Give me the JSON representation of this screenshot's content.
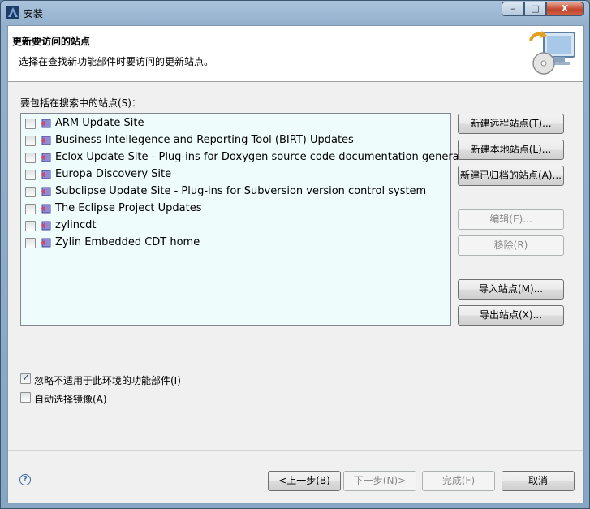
{
  "window": {
    "title": "安装",
    "controls": {
      "minimize": "–",
      "maximize": "□",
      "close": "X"
    }
  },
  "header": {
    "title": "更新要访问的站点",
    "description": "选择在查找新功能部件时要访问的更新站点。",
    "graphic_icon": "install-wizard-graphic"
  },
  "sites": {
    "label": "要包括在搜索中的站点(S)：",
    "items": [
      {
        "name": "ARM Update Site",
        "checked": false
      },
      {
        "name": "Business Intellegence and Reporting Tool (BIRT) Updates",
        "checked": false
      },
      {
        "name": "Eclox Update Site - Plug-ins for Doxygen source code documentation generator",
        "checked": false
      },
      {
        "name": "Europa Discovery Site",
        "checked": false
      },
      {
        "name": "Subclipse Update Site - Plug-ins for Subversion version control system",
        "checked": false
      },
      {
        "name": "The Eclipse Project Updates",
        "checked": false
      },
      {
        "name": "zylincdt",
        "checked": false
      },
      {
        "name": "Zylin Embedded CDT home",
        "checked": false
      }
    ]
  },
  "side_buttons": {
    "new_remote": "新建远程站点(T)...",
    "new_local": "新建本地站点(L)...",
    "new_archived": "新建已归档的站点(A)...",
    "edit": "编辑(E)...",
    "remove": "移除(R)",
    "import": "导入站点(M)...",
    "export": "导出站点(X)..."
  },
  "options": {
    "ignore_features": {
      "label": "忽略不适用于此环境的功能部件(I)",
      "checked": true
    },
    "auto_mirror": {
      "label": "自动选择镜像(A)",
      "checked": false
    }
  },
  "footer": {
    "help_icon": "?",
    "back": "<上一步(B)",
    "next": "下一步(N)>",
    "finish": "完成(F)",
    "cancel": "取消"
  },
  "colors": {
    "list_background": "#eefcfc",
    "header_background": "#ffffff",
    "dialog_background": "#f0f0f0"
  }
}
